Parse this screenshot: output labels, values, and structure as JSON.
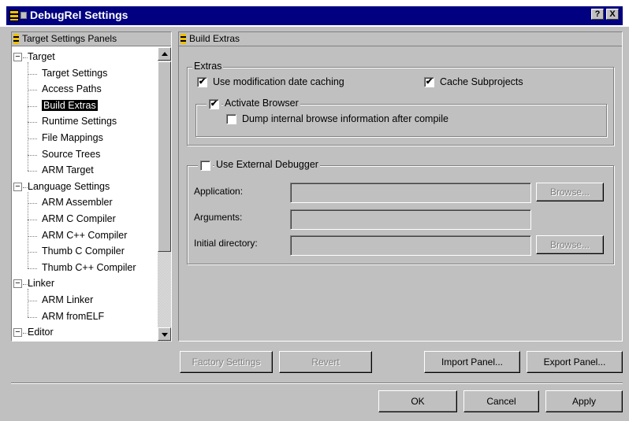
{
  "window": {
    "title": "DebugRel Settings",
    "help_btn": "?",
    "close_btn": "X"
  },
  "left_panel": {
    "header": "Target Settings Panels",
    "tree": [
      {
        "label": "Target",
        "level": 0,
        "expander": "−"
      },
      {
        "label": "Target Settings",
        "level": 1
      },
      {
        "label": "Access Paths",
        "level": 1
      },
      {
        "label": "Build Extras",
        "level": 1,
        "selected": true
      },
      {
        "label": "Runtime Settings",
        "level": 1
      },
      {
        "label": "File Mappings",
        "level": 1
      },
      {
        "label": "Source Trees",
        "level": 1
      },
      {
        "label": "ARM Target",
        "level": 1
      },
      {
        "label": "Language Settings",
        "level": 0,
        "expander": "−"
      },
      {
        "label": "ARM Assembler",
        "level": 1
      },
      {
        "label": "ARM C Compiler",
        "level": 1
      },
      {
        "label": "ARM C++ Compiler",
        "level": 1
      },
      {
        "label": "Thumb C Compiler",
        "level": 1
      },
      {
        "label": "Thumb C++ Compiler",
        "level": 1
      },
      {
        "label": "Linker",
        "level": 0,
        "expander": "−"
      },
      {
        "label": "ARM Linker",
        "level": 1
      },
      {
        "label": "ARM fromELF",
        "level": 1
      },
      {
        "label": "Editor",
        "level": 0,
        "expander": "−"
      }
    ]
  },
  "right_panel": {
    "header": "Build Extras",
    "extras": {
      "label": "Extras",
      "use_mod_date": {
        "label": "Use modification date caching",
        "checked": "✔"
      },
      "cache_subprojects": {
        "label": "Cache Subprojects",
        "checked": "✔"
      },
      "activate_browser": {
        "label": "Activate Browser",
        "checked": "✔"
      },
      "dump_browse": {
        "label": "Dump internal browse information after compile",
        "checked": ""
      }
    },
    "debugger": {
      "label": "Use External Debugger",
      "checked": "",
      "application_label": "Application:",
      "arguments_label": "Arguments:",
      "initial_dir_label": "Initial directory:",
      "browse": "Browse..."
    }
  },
  "buttons": {
    "factory": "Factory Settings",
    "revert": "Revert",
    "import": "Import Panel...",
    "export": "Export Panel...",
    "ok": "OK",
    "cancel": "Cancel",
    "apply": "Apply"
  }
}
